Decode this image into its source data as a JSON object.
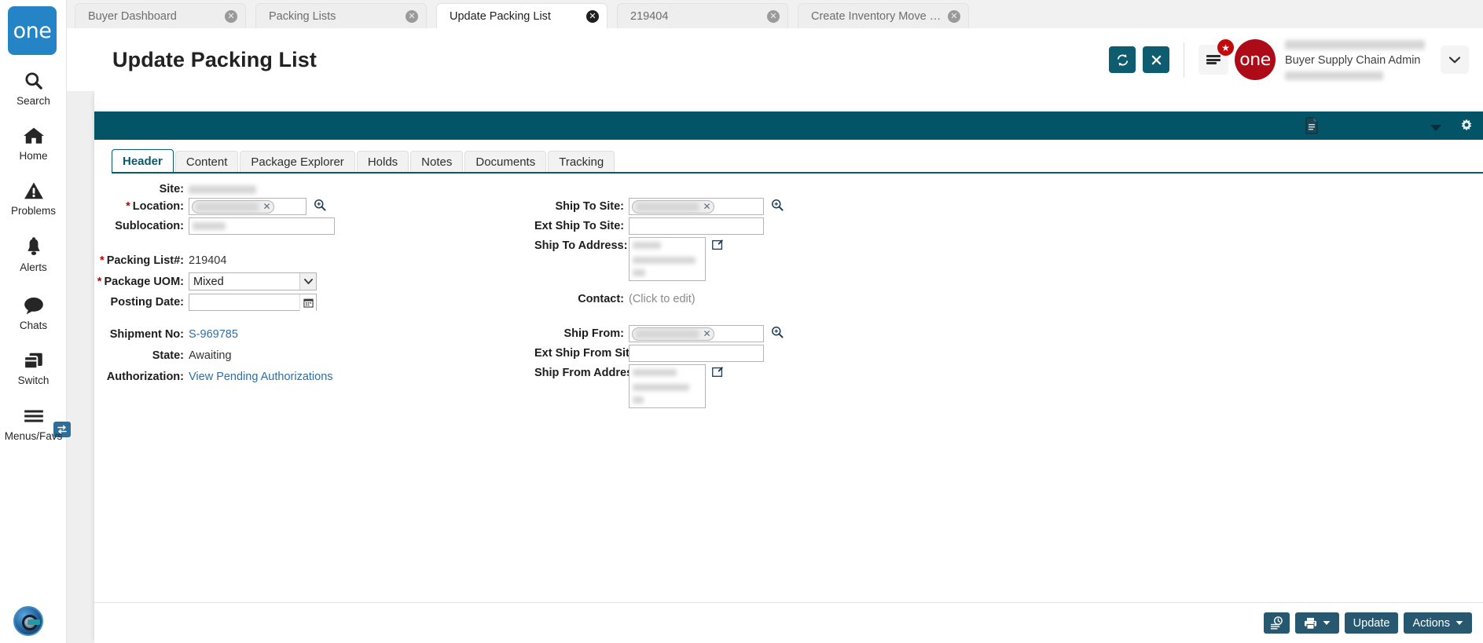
{
  "app": {
    "logo_text": "one",
    "brand_badge_text": "one",
    "teal_color": "#045468",
    "accent_blue": "#2484c6",
    "brand_red": "#ad0b18",
    "button_color": "#27586f",
    "link_color": "#2d6ea8"
  },
  "workspace_tabs": [
    {
      "label": "Buyer Dashboard",
      "active": false,
      "close": "✕"
    },
    {
      "label": "Packing Lists",
      "active": false,
      "close": "✕"
    },
    {
      "label": "Update Packing List",
      "active": true,
      "close": "✕"
    },
    {
      "label": "219404",
      "active": false,
      "close": "✕"
    },
    {
      "label": "Create Inventory Move Order",
      "active": false,
      "close": "✕"
    }
  ],
  "sidebar": {
    "items": [
      {
        "label": "Search",
        "icon": "search-icon"
      },
      {
        "label": "Home",
        "icon": "home-icon"
      },
      {
        "label": "Problems",
        "icon": "warning-triangle-icon"
      },
      {
        "label": "Alerts",
        "icon": "bell-icon"
      },
      {
        "label": "Chats",
        "icon": "chat-bubble-icon"
      },
      {
        "label": "Switch",
        "icon": "switch-windows-icon"
      },
      {
        "label": "Menus/Favs",
        "icon": "hamburger-icon"
      }
    ]
  },
  "header": {
    "title": "Update Packing List",
    "refresh_icon": "refresh-icon",
    "close_icon": "close-icon",
    "menu_icon": "hamburger-icon",
    "star_badge": "★",
    "user_role": "Buyer Supply Chain Admin",
    "user_caret": "▾"
  },
  "toolbar": {
    "doc_icon": "document-icon",
    "caret_icon": "▼",
    "gear_icon": "gear-icon"
  },
  "form_tabs": [
    {
      "label": "Header",
      "active": true
    },
    {
      "label": "Content",
      "active": false
    },
    {
      "label": "Package Explorer",
      "active": false
    },
    {
      "label": "Holds",
      "active": false
    },
    {
      "label": "Notes",
      "active": false
    },
    {
      "label": "Documents",
      "active": false
    },
    {
      "label": "Tracking",
      "active": false
    }
  ],
  "form": {
    "site": {
      "label": "Site:",
      "value": "",
      "redacted": true
    },
    "location": {
      "label": "Location:",
      "required": true,
      "value": "",
      "redacted": true,
      "clear": "✕",
      "picker": "magnifier-icon"
    },
    "sublocation": {
      "label": "Sublocation:",
      "value": "",
      "redacted": true
    },
    "packing_list_no": {
      "label": "Packing List#:",
      "required": true,
      "value": "219404"
    },
    "package_uom": {
      "label": "Package UOM:",
      "required": true,
      "value": "Mixed",
      "options": [
        "Mixed"
      ]
    },
    "posting_date": {
      "label": "Posting Date:",
      "value": "",
      "placeholder": ""
    },
    "shipment_no": {
      "label": "Shipment No:",
      "value": "S-969785",
      "is_link": true
    },
    "state": {
      "label": "State:",
      "value": "Awaiting"
    },
    "authorization": {
      "label": "Authorization:",
      "value": "View Pending Authorizations",
      "is_link": true
    },
    "ship_to_site": {
      "label": "Ship To Site:",
      "value": "",
      "redacted": true,
      "clear": "✕",
      "picker": "magnifier-icon"
    },
    "ext_ship_to_site": {
      "label": "Ext Ship To Site:",
      "value": "",
      "placeholder": ""
    },
    "ship_to_address": {
      "label": "Ship To Address:",
      "value": "",
      "redacted": true,
      "edit": "edit-icon"
    },
    "contact": {
      "label": "Contact:",
      "value": "(Click to edit)"
    },
    "ship_from": {
      "label": "Ship From:",
      "value": "",
      "redacted": true,
      "clear": "✕",
      "picker": "magnifier-icon"
    },
    "ext_ship_from_site": {
      "label": "Ext Ship From Site:",
      "value": "",
      "placeholder": ""
    },
    "ship_from_address": {
      "label": "Ship From Address:",
      "value": "",
      "redacted": true,
      "edit": "edit-icon"
    }
  },
  "footer": {
    "history_icon": "history-log-icon",
    "print_icon": "printer-icon",
    "print_caret": "▾",
    "update_label": "Update",
    "actions_label": "Actions",
    "actions_caret": "▾"
  }
}
